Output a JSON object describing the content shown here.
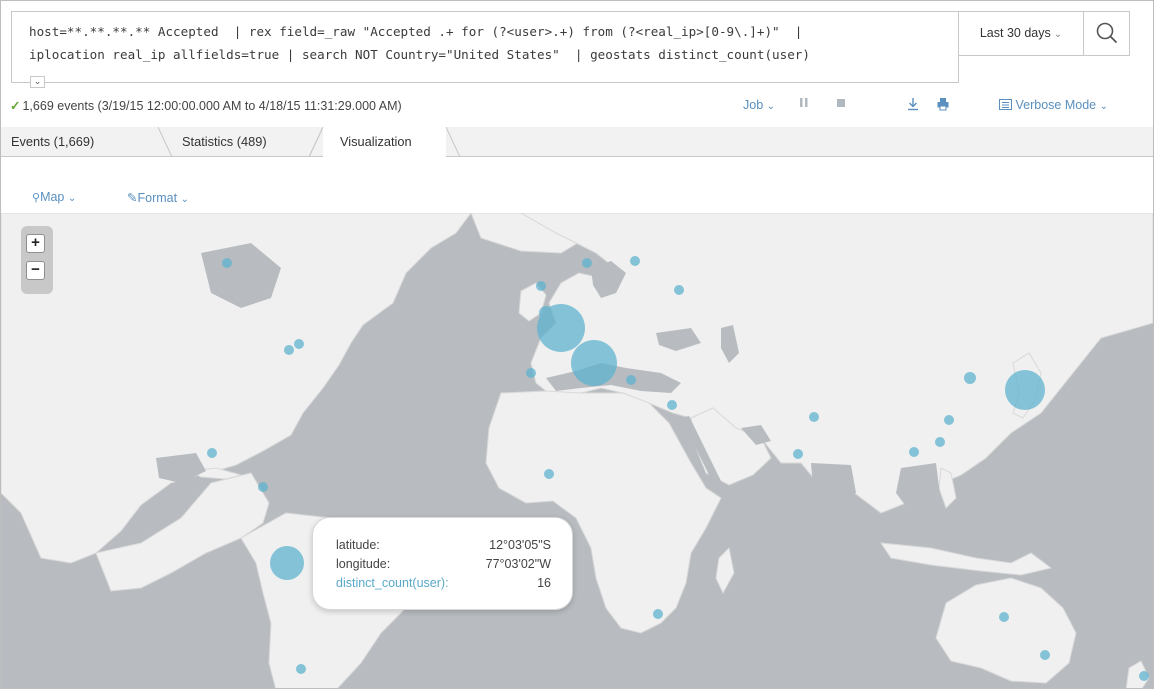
{
  "search": {
    "query_line1": "host=**.**.**.** Accepted  | rex field=_raw \"Accepted .+ for (?<user>.+) from (?<real_ip>[0-9\\.]+)\"  |",
    "query_line2": "iplocation real_ip allfields=true | search NOT Country=\"United States\"  | geostats distinct_count(user)",
    "time_range": "Last 30 days",
    "collapse_icon": "chevron-down-icon",
    "search_icon": "search-icon"
  },
  "status": {
    "events_text": "1,669 events (3/19/15 12:00:00.000 AM to 4/18/15 11:31:29.000 AM)",
    "job_label": "Job",
    "verbose_label": "Verbose Mode",
    "controls": [
      "pause-icon",
      "stop-icon",
      "export-icon",
      "print-icon"
    ]
  },
  "tabs": [
    {
      "label": "Events (1,669)",
      "active": false
    },
    {
      "label": "Statistics (489)",
      "active": false
    },
    {
      "label": "Visualization",
      "active": true
    }
  ],
  "viz": {
    "map_button": "Map",
    "format_button": "Format"
  },
  "map": {
    "zoom_in": "+",
    "zoom_out": "−",
    "colors": {
      "land": "#f0f0f0",
      "water": "#b8bcc0",
      "marker": "#5fb3cf"
    },
    "tooltip": {
      "latitude_label": "latitude:",
      "latitude_value": "12°03'05\"S",
      "longitude_label": "longitude:",
      "longitude_value": "77°03'02\"W",
      "count_label": "distinct_count(user):",
      "count_value": "16"
    }
  }
}
